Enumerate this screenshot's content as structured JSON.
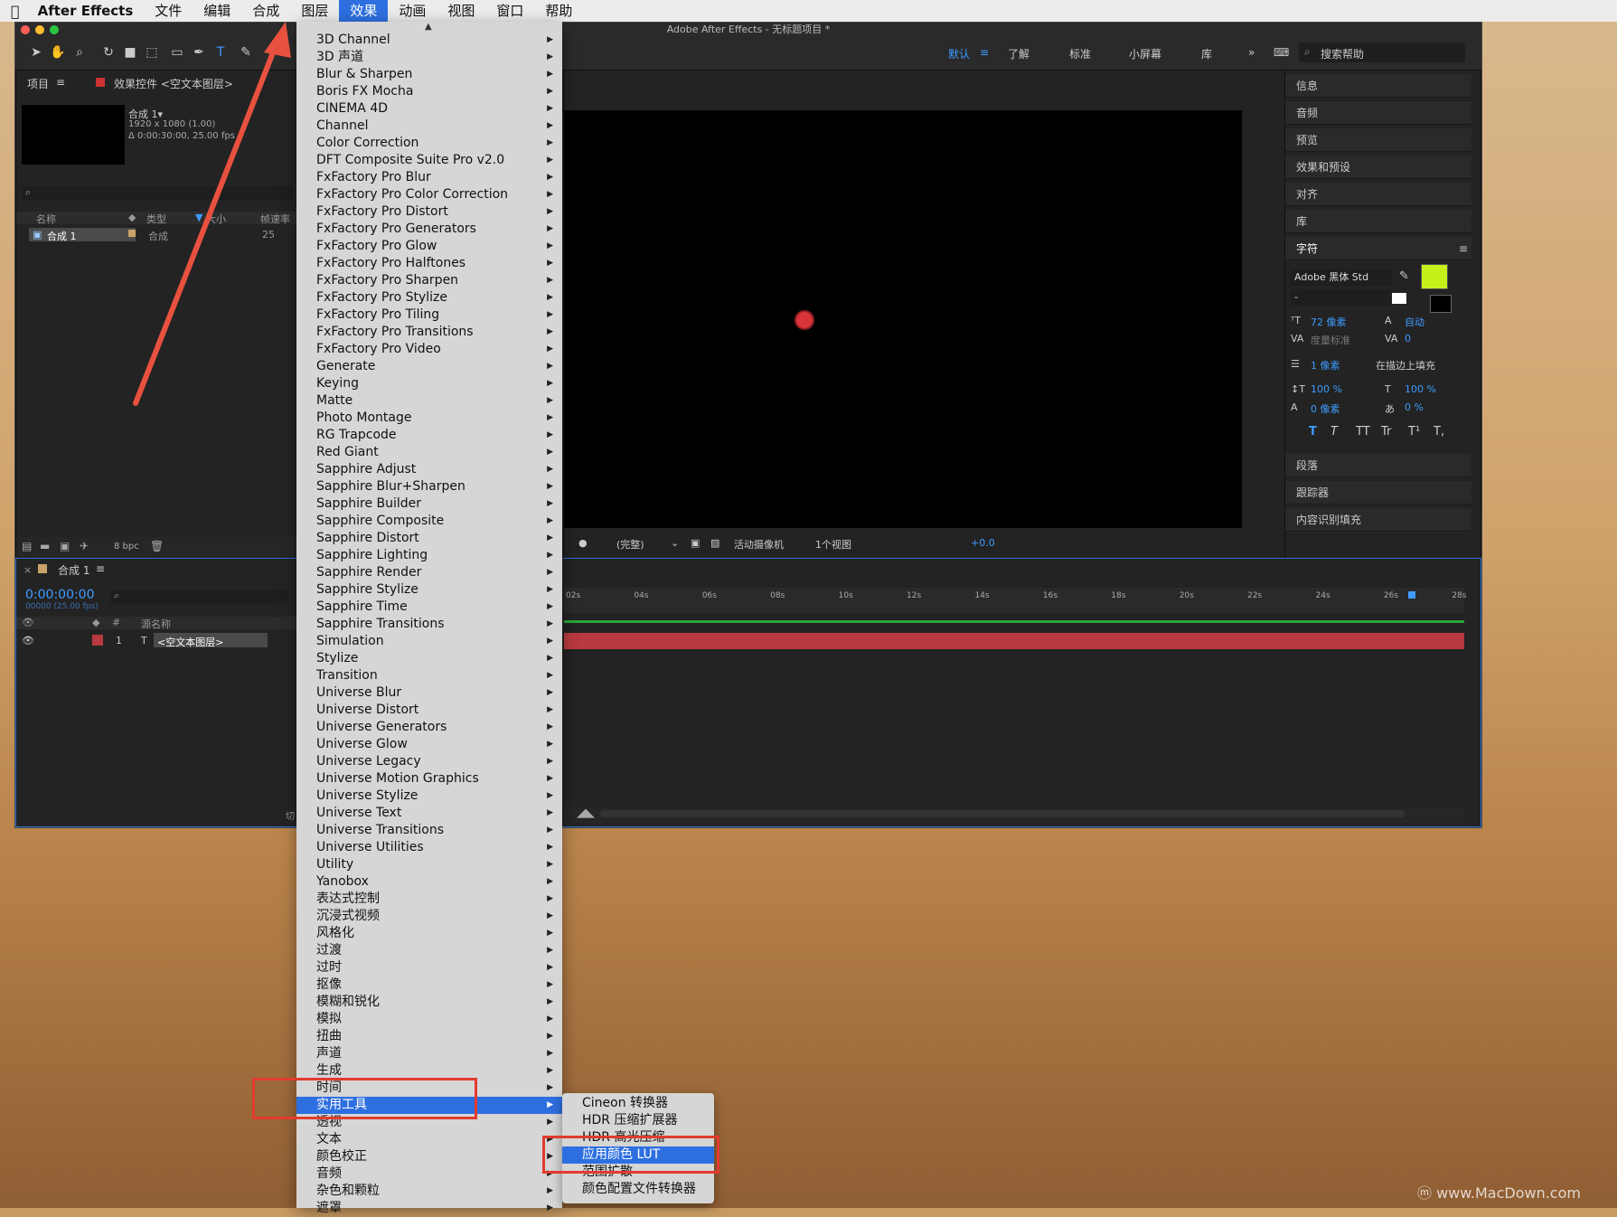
{
  "menubar": {
    "apple": "",
    "app": "After Effects",
    "items": [
      "文件",
      "编辑",
      "合成",
      "图层",
      "效果",
      "动画",
      "视图",
      "窗口",
      "帮助"
    ],
    "active": "效果"
  },
  "window": {
    "title": "Adobe After Effects - 无标题项目 *",
    "workspaces": [
      "默认",
      "了解",
      "标准",
      "小屏幕",
      "库"
    ],
    "search_help": "搜索帮助"
  },
  "project_panel": {
    "tab_project": "项目",
    "tab_effects": "效果控件 <空文本图层>",
    "comp_name": "合成 1▾",
    "comp_res": "1920 x 1080 (1.00)",
    "comp_dur": "Δ 0:00:30:00, 25.00 fps",
    "col_name": "名称",
    "col_type": "类型",
    "col_size": "大小",
    "col_fps": "帧速率",
    "row_name": "合成 1",
    "row_type": "合成",
    "row_fps": "25",
    "bpc": "8 bpc"
  },
  "viewer": {
    "quality": "(完整)",
    "camera": "活动摄像机",
    "views": "1个视图",
    "exposure": "+0.0"
  },
  "right_panel": {
    "items": [
      "信息",
      "音频",
      "预览",
      "效果和预设",
      "对齐",
      "库"
    ],
    "char_title": "字符",
    "font": "Adobe 黑体 Std",
    "font_style": "-",
    "size": "72 像素",
    "leading": "自动",
    "kerning": "度量标准",
    "tracking": "0",
    "stroke": "1 像素",
    "stroke_mode": "在描边上填充",
    "vscale": "100 %",
    "hscale": "100 %",
    "baseline": "0 像素",
    "tsume": "0 %",
    "styles": [
      "T",
      "T",
      "TT",
      "Tr",
      "T¹",
      "T,"
    ],
    "bottom_items": [
      "段落",
      "跟踪器",
      "内容识别填充"
    ],
    "fill_color": "#c6f01a"
  },
  "timeline": {
    "tab": "合成 1",
    "timecode": "0:00:00:00",
    "timecode_sub": "00000 (25.00 fps)",
    "col_source": "源名称",
    "layer_num": "1",
    "layer_name": "<空文本图层>",
    "ticks": [
      "02s",
      "04s",
      "06s",
      "08s",
      "10s",
      "12s",
      "14s",
      "16s",
      "18s",
      "20s",
      "22s",
      "24s",
      "26s",
      "28s"
    ],
    "footer": "切"
  },
  "effects_menu": {
    "items": [
      "3D Channel",
      "3D 声道",
      "Blur & Sharpen",
      "Boris FX Mocha",
      "CINEMA 4D",
      "Channel",
      "Color Correction",
      "DFT Composite Suite Pro v2.0",
      "FxFactory Pro Blur",
      "FxFactory Pro Color Correction",
      "FxFactory Pro Distort",
      "FxFactory Pro Generators",
      "FxFactory Pro Glow",
      "FxFactory Pro Halftones",
      "FxFactory Pro Sharpen",
      "FxFactory Pro Stylize",
      "FxFactory Pro Tiling",
      "FxFactory Pro Transitions",
      "FxFactory Pro Video",
      "Generate",
      "Keying",
      "Matte",
      "Photo Montage",
      "RG Trapcode",
      "Red Giant",
      "Sapphire Adjust",
      "Sapphire Blur+Sharpen",
      "Sapphire Builder",
      "Sapphire Composite",
      "Sapphire Distort",
      "Sapphire Lighting",
      "Sapphire Render",
      "Sapphire Stylize",
      "Sapphire Time",
      "Sapphire Transitions",
      "Simulation",
      "Stylize",
      "Transition",
      "Universe Blur",
      "Universe Distort",
      "Universe Generators",
      "Universe Glow",
      "Universe Legacy",
      "Universe Motion Graphics",
      "Universe Stylize",
      "Universe Text",
      "Universe Transitions",
      "Universe Utilities",
      "Utility",
      "Yanobox",
      "表达式控制",
      "沉浸式视频",
      "风格化",
      "过渡",
      "过时",
      "抠像",
      "模糊和锐化",
      "模拟",
      "扭曲",
      "声道",
      "生成",
      "时间",
      "实用工具",
      "透视",
      "文本",
      "颜色校正",
      "音频",
      "杂色和颗粒",
      "遮罩"
    ],
    "selected_index": 62,
    "up_arrow": "▲"
  },
  "submenu": {
    "items": [
      "Cineon 转换器",
      "HDR 压缩扩展器",
      "HDR 高光压缩",
      "应用颜色 LUT",
      "范围扩散",
      "颜色配置文件转换器"
    ],
    "selected_index": 3
  },
  "watermark": "www.MacDown.com",
  "colors": {
    "highlight": "#2e6fe0",
    "annotation": "#e23b2e",
    "layer_bar": "#b8393f",
    "accent_blue": "#3d9bff"
  }
}
